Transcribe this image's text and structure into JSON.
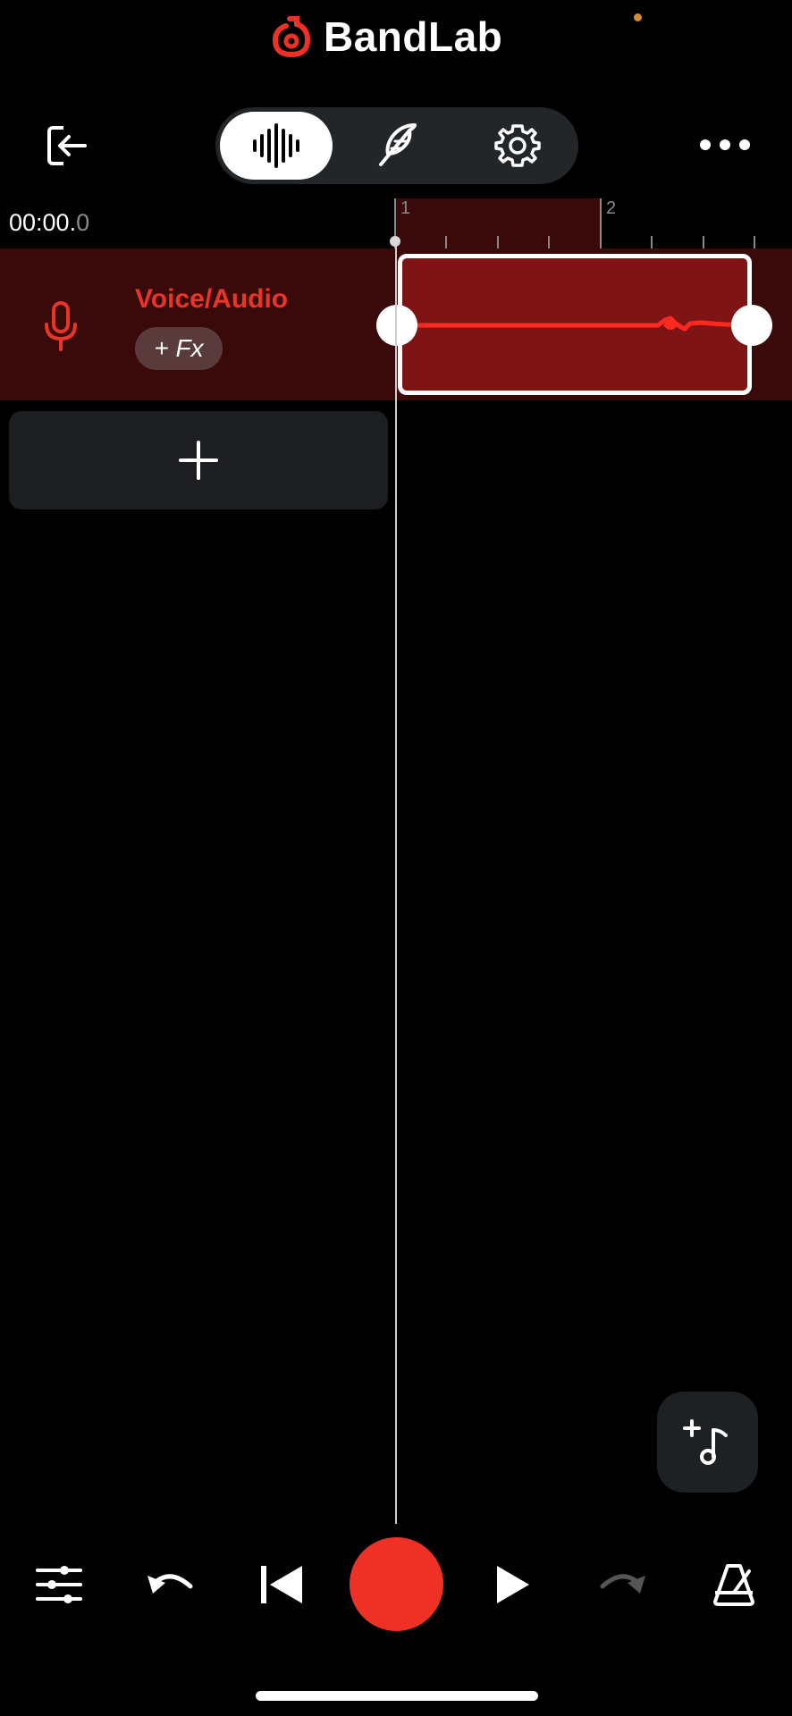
{
  "header": {
    "brand_name": "BandLab",
    "brand_color": "#ee3124",
    "exit_icon": "exit-arrow-icon",
    "more_icon": "more-dots-icon"
  },
  "mode_switch": {
    "tabs": [
      {
        "name": "waveform",
        "icon": "waveform-icon",
        "active": true
      },
      {
        "name": "lyrics",
        "icon": "feather-icon",
        "active": false
      },
      {
        "name": "settings",
        "icon": "gear-icon",
        "active": false
      }
    ]
  },
  "timeline": {
    "time_main": "00:00.",
    "time_fraction": "0",
    "bars": [
      "1",
      "2"
    ]
  },
  "tracks": [
    {
      "name": "Voice/Audio",
      "fx_label": "+ Fx",
      "icon": "microphone-icon",
      "color": "#e8352a",
      "region_color": "#7f1414"
    }
  ],
  "add_track": {
    "icon": "plus-icon"
  },
  "fab": {
    "icon": "add-instrument-icon"
  },
  "transport": {
    "mixer_icon": "mixer-sliders-icon",
    "undo_icon": "undo-icon",
    "rewind_icon": "skip-back-icon",
    "record_color": "#ee3124",
    "play_icon": "play-icon",
    "redo_icon": "redo-icon",
    "metronome_icon": "metronome-icon"
  }
}
